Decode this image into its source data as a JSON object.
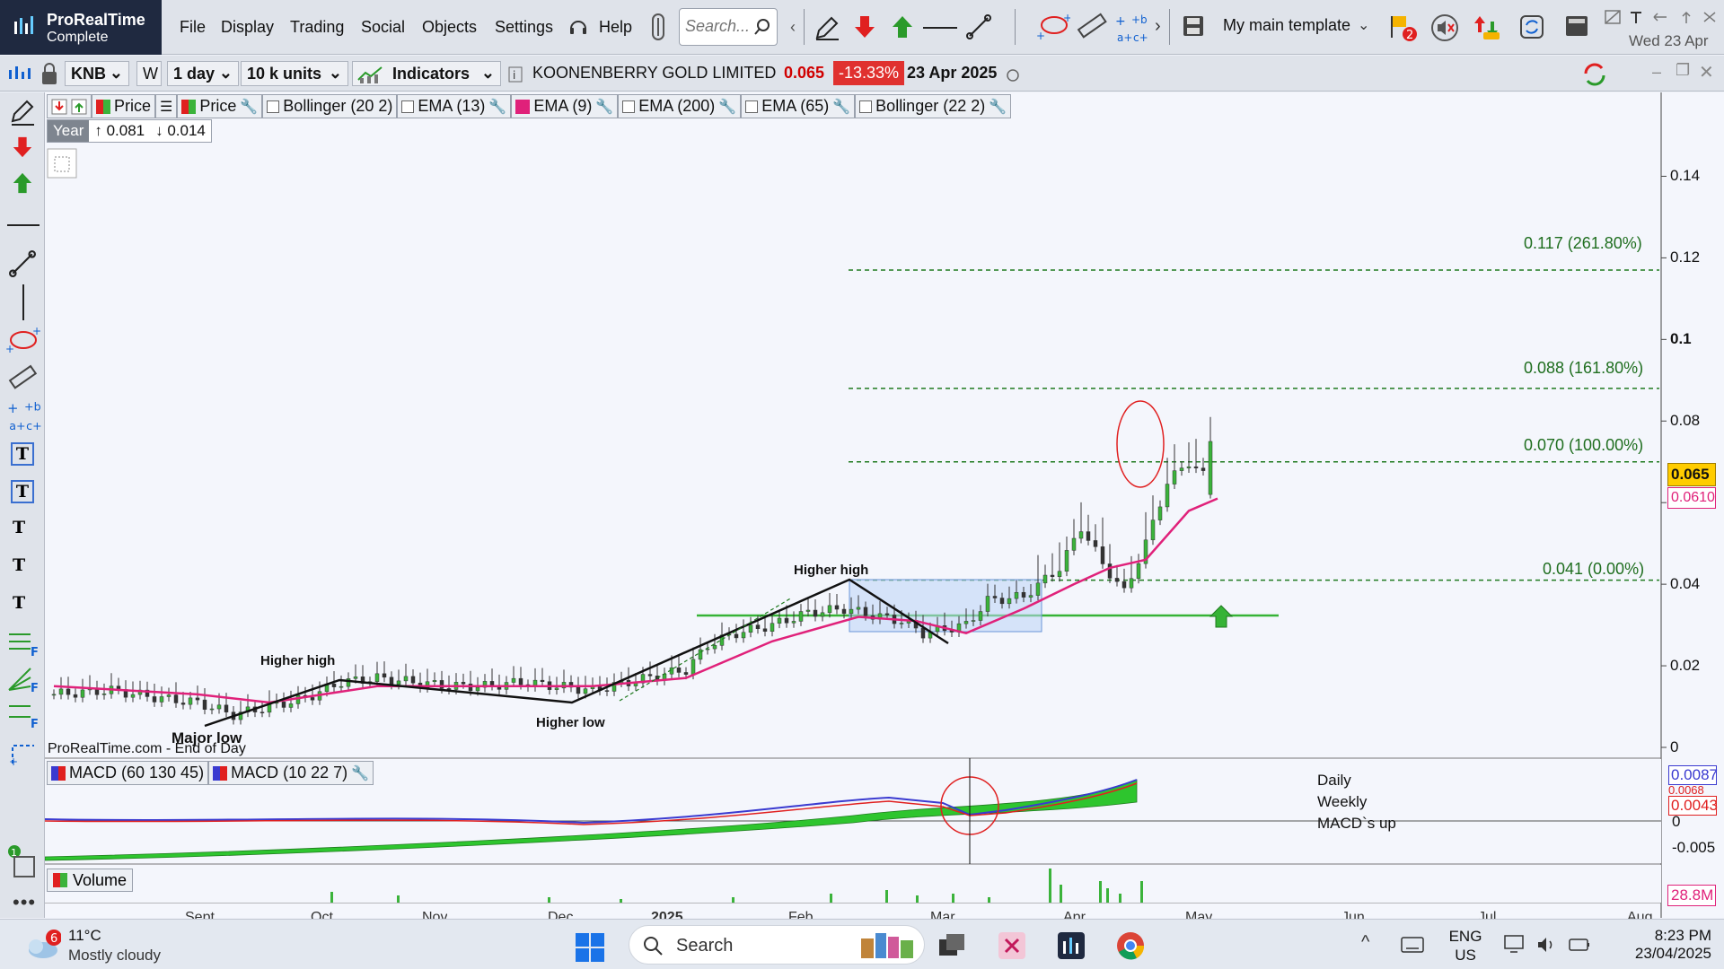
{
  "app": {
    "name": "ProRealTime",
    "edition": "Complete"
  },
  "menu": [
    "File",
    "Display",
    "Trading",
    "Social",
    "Objects",
    "Settings",
    "Help"
  ],
  "search_placeholder": "Search...",
  "template": "My main template",
  "top_date": "Wed 23 Apr",
  "notification_badge": "2",
  "instrument": {
    "ticker": "KNB",
    "period_toggle": "W",
    "timeframe": "1 day",
    "units": "10 k units",
    "indicators_label": "Indicators",
    "name": "KOONENBERRY GOLD LIMITED",
    "last": "0.065",
    "change": "-13.33%",
    "date": "23 Apr 2025"
  },
  "indicators": [
    {
      "label": "Price",
      "color": "#3bb33b",
      "checked": true
    },
    {
      "label": "Price",
      "color": "#3bb33b",
      "checked": true
    },
    {
      "label": "Bollinger (20 2)",
      "color": null,
      "checked": false
    },
    {
      "label": "EMA (13)",
      "color": null,
      "checked": false
    },
    {
      "label": "EMA (9)",
      "color": "#e0217a",
      "checked": true
    },
    {
      "label": "EMA (200)",
      "color": null,
      "checked": false
    },
    {
      "label": "EMA (65)",
      "color": null,
      "checked": false
    },
    {
      "label": "Bollinger (22 2)",
      "color": null,
      "checked": false
    }
  ],
  "range": {
    "period": "Year",
    "high": "↑ 0.081",
    "low": "↓ 0.014"
  },
  "fib_levels": [
    {
      "label": "0.117 (261.80%)",
      "value": 0.117
    },
    {
      "label": "0.088 (161.80%)",
      "value": 0.088
    },
    {
      "label": "0.070 (100.00%)",
      "value": 0.07
    },
    {
      "label": "0.041 (0.00%)",
      "value": 0.041
    }
  ],
  "annotations": {
    "higher_high_1": "Higher high",
    "major_low": "Major low",
    "higher_low": "Higher low",
    "higher_high_2": "Higher high"
  },
  "price_label": "0.065",
  "ema_label": "0.0610",
  "source_label": "ProRealTime.com - End of Day",
  "macd": {
    "labels": [
      "MACD (60 130 45)",
      "MACD (10 22 7)"
    ],
    "note": [
      "Daily",
      "Weekly",
      "MACD`s up"
    ],
    "value1": "0.0087",
    "value2": "0.0068",
    "value3": "0.0043",
    "ticks": [
      "0",
      "-0.005"
    ]
  },
  "volume": {
    "label": "Volume",
    "value": "28.8M"
  },
  "chart_data": {
    "type": "candlestick",
    "x_ticks": [
      "Sept",
      "Oct",
      "Nov",
      "Dec",
      "2025",
      "Feb",
      "Mar",
      "Apr",
      "May",
      "Jun",
      "Jul",
      "Aug"
    ],
    "y_ticks": [
      0,
      0.02,
      0.04,
      0.06,
      0.08,
      0.1,
      0.12,
      0.14
    ],
    "ylim": [
      0,
      0.15
    ],
    "close_path": [
      [
        0,
        0.013
      ],
      [
        8,
        0.014
      ],
      [
        15,
        0.012
      ],
      [
        20,
        0.011
      ],
      [
        25,
        0.008
      ],
      [
        30,
        0.01
      ],
      [
        35,
        0.012
      ],
      [
        40,
        0.016
      ],
      [
        45,
        0.017
      ],
      [
        50,
        0.016
      ],
      [
        55,
        0.015
      ],
      [
        60,
        0.015
      ],
      [
        65,
        0.016
      ],
      [
        70,
        0.015
      ],
      [
        75,
        0.014
      ],
      [
        80,
        0.016
      ],
      [
        85,
        0.018
      ],
      [
        88,
        0.019
      ],
      [
        91,
        0.025
      ],
      [
        95,
        0.028
      ],
      [
        100,
        0.03
      ],
      [
        105,
        0.033
      ],
      [
        110,
        0.034
      ],
      [
        115,
        0.032
      ],
      [
        118,
        0.031
      ],
      [
        121,
        0.028
      ],
      [
        124,
        0.029
      ],
      [
        127,
        0.03
      ],
      [
        130,
        0.036
      ],
      [
        135,
        0.037
      ],
      [
        140,
        0.044
      ],
      [
        143,
        0.054
      ],
      [
        146,
        0.045
      ],
      [
        149,
        0.038
      ],
      [
        152,
        0.05
      ],
      [
        155,
        0.065
      ],
      [
        158,
        0.07
      ],
      [
        161,
        0.065
      ]
    ],
    "ema_path": [
      [
        0,
        0.015
      ],
      [
        20,
        0.013
      ],
      [
        30,
        0.011
      ],
      [
        45,
        0.015
      ],
      [
        60,
        0.015
      ],
      [
        75,
        0.015
      ],
      [
        88,
        0.017
      ],
      [
        100,
        0.026
      ],
      [
        112,
        0.032
      ],
      [
        120,
        0.031
      ],
      [
        127,
        0.028
      ],
      [
        135,
        0.034
      ],
      [
        142,
        0.04
      ],
      [
        147,
        0.044
      ],
      [
        152,
        0.046
      ],
      [
        158,
        0.058
      ],
      [
        162,
        0.061
      ]
    ]
  }
}
